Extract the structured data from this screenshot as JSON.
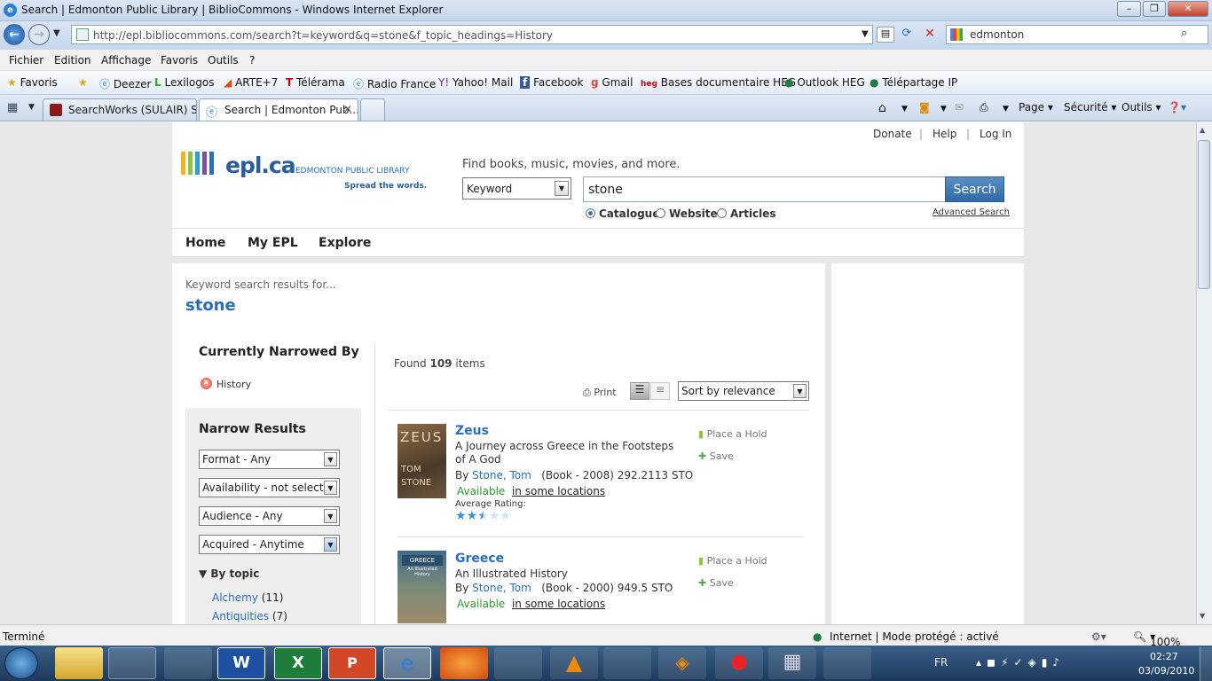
{
  "window": {
    "title": "Search | Edmonton Public Library | BiblioCommons - Windows Internet Explorer"
  },
  "browser": {
    "address": "http://epl.bibliocommons.com/search?t=keyword&q=stone&f_topic_headings=History",
    "search_box": "edmonton",
    "menu": [
      "Fichier",
      "Edition",
      "Affichage",
      "Favoris",
      "Outils",
      "?"
    ],
    "favorites_label": "Favoris",
    "favorites": [
      "Deezer",
      "Lexilogos",
      "ARTE+7",
      "Télérama",
      "Radio France",
      "Yahoo! Mail",
      "Facebook",
      "Gmail",
      "Bases documentaire HEG",
      "Outlook HEG",
      "Télépartage IP"
    ],
    "tabs": [
      "SearchWorks (SULAIR) Sea...",
      "Search | Edmonton Pub..."
    ],
    "commands": [
      "Page",
      "Sécurité",
      "Outils"
    ],
    "status_left": "Terminé",
    "status_zone": "Internet | Mode protégé : activé",
    "zoom": "100%"
  },
  "site": {
    "toplinks": [
      "Donate",
      "Help",
      "Log In"
    ],
    "logo": "epl.ca",
    "logo_sub": "EDMONTON PUBLIC LIBRARY",
    "logo_tag": "Spread the words.",
    "tagline": "Find books, music, movies, and more.",
    "search_type": "Keyword",
    "query": "stone",
    "search_button": "Search",
    "scopes": [
      "Catalogue",
      "Website",
      "Articles"
    ],
    "advanced": "Advanced Search",
    "nav": [
      "Home",
      "My EPL",
      "Explore"
    ]
  },
  "results": {
    "intro": "Keyword search results for...",
    "term": "stone",
    "narrowed_heading": "Currently Narrowed By",
    "narrowed_item": "History",
    "found_pre": "Found",
    "found_count": "109",
    "found_post": "items",
    "print": "Print",
    "sort": "Sort by relevance",
    "narrow_heading": "Narrow Results",
    "filters": [
      "Format - Any",
      "Availability - not selected",
      "Audience - Any",
      "Acquired - Anytime"
    ],
    "by_topic": "By topic",
    "topics": [
      {
        "name": "Alchemy",
        "count": "(11)"
      },
      {
        "name": "Antiquities",
        "count": "(7)"
      }
    ],
    "items": [
      {
        "title": "Zeus",
        "subtitle": "A Journey across Greece in the Footsteps of A God",
        "by": "By",
        "author": "Stone, Tom",
        "meta": "(Book - 2008) 292.2113 STO",
        "avail": "Available",
        "loc": "in some locations",
        "rating_label": "Average Rating:",
        "rating": 2.5,
        "hold": "Place a Hold",
        "save": "Save",
        "cover_title": "ZEUS",
        "cover_author": "TOM STONE"
      },
      {
        "title": "Greece",
        "subtitle": "An Illustrated History",
        "by": "By",
        "author": "Stone, Tom",
        "meta": "(Book - 2000) 949.5 STO",
        "avail": "Available",
        "loc": "in some locations",
        "hold": "Place a Hold",
        "save": "Save",
        "cover_title": "GREECE",
        "cover_author": "An Illustrated History"
      }
    ]
  },
  "system": {
    "lang": "FR",
    "time": "02:27",
    "date": "03/09/2010"
  }
}
